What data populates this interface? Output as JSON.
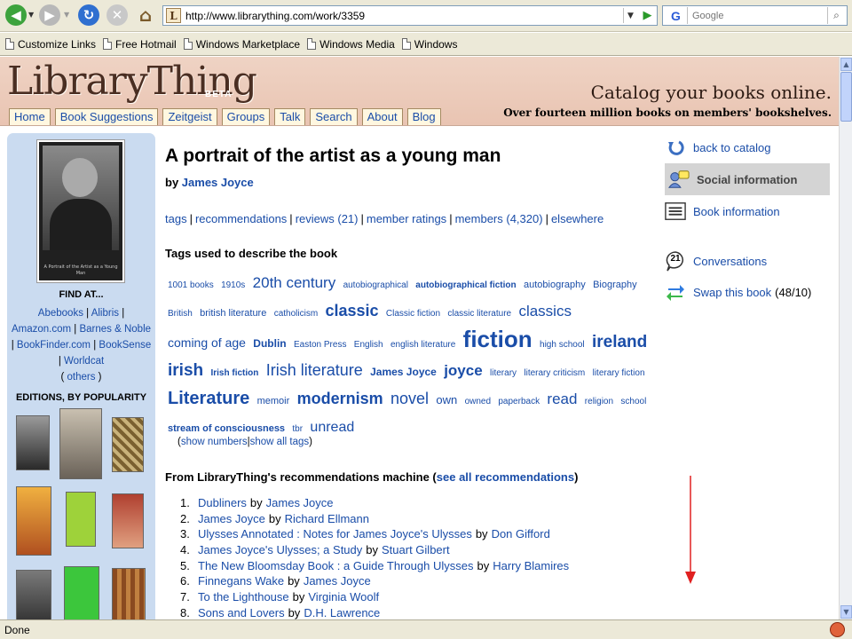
{
  "browser": {
    "url": "http://www.librarything.com/work/3359",
    "search_placeholder": "Google",
    "search_engine_letter": "G",
    "site_icon_letter": "L",
    "bookmarks": [
      "Customize Links",
      "Free Hotmail",
      "Windows Marketplace",
      "Windows Media",
      "Windows"
    ],
    "status": "Done"
  },
  "site": {
    "logo": "LibraryThing",
    "beta": "BETA",
    "tagline": "Catalog your books online.",
    "subtagline": "Over fourteen million books on members' bookshelves.",
    "tabs": [
      "Home",
      "Book Suggestions",
      "Zeitgeist",
      "Groups",
      "Talk",
      "Search",
      "About",
      "Blog"
    ]
  },
  "book": {
    "title": "A portrait of the artist as a young man",
    "by_label": "by",
    "author": "James Joyce",
    "cover_text": "A Portrait of the Artist as a Young Man"
  },
  "subnav": {
    "tags": "tags",
    "recommendations": "recommendations",
    "reviews": "reviews (21)",
    "member_ratings": "member ratings",
    "members": "members (4,320)",
    "elsewhere": "elsewhere"
  },
  "tags_heading": "Tags used to describe the book",
  "tags": [
    {
      "t": "1001 books",
      "s": 10
    },
    {
      "t": "1910s",
      "s": 10
    },
    {
      "t": "20th century",
      "s": 17
    },
    {
      "t": "autobiographical",
      "s": 10
    },
    {
      "t": "autobiographical fiction",
      "s": 10,
      "b": true
    },
    {
      "t": "autobiography",
      "s": 11
    },
    {
      "t": "Biography",
      "s": 11
    },
    {
      "t": "British",
      "s": 10
    },
    {
      "t": "british literature",
      "s": 11
    },
    {
      "t": "catholicism",
      "s": 10
    },
    {
      "t": "classic",
      "s": 18,
      "b": true
    },
    {
      "t": "Classic fiction",
      "s": 10
    },
    {
      "t": "classic literature",
      "s": 10
    },
    {
      "t": "classics",
      "s": 17
    },
    {
      "t": "coming of age",
      "s": 14
    },
    {
      "t": "Dublin",
      "s": 12,
      "b": true
    },
    {
      "t": "Easton Press",
      "s": 10
    },
    {
      "t": "English",
      "s": 10
    },
    {
      "t": "english literature",
      "s": 10
    },
    {
      "t": "fiction",
      "s": 26,
      "b": true
    },
    {
      "t": "high school",
      "s": 10
    },
    {
      "t": "ireland",
      "s": 19,
      "b": true
    },
    {
      "t": "irish",
      "s": 19,
      "b": true
    },
    {
      "t": "Irish fiction",
      "s": 10,
      "b": true
    },
    {
      "t": "Irish literature",
      "s": 18
    },
    {
      "t": "James Joyce",
      "s": 12,
      "b": true
    },
    {
      "t": "joyce",
      "s": 17,
      "b": true
    },
    {
      "t": "literary",
      "s": 10
    },
    {
      "t": "literary criticism",
      "s": 10
    },
    {
      "t": "literary fiction",
      "s": 10
    },
    {
      "t": "Literature",
      "s": 20,
      "b": true
    },
    {
      "t": "memoir",
      "s": 11
    },
    {
      "t": "modernism",
      "s": 18,
      "b": true
    },
    {
      "t": "novel",
      "s": 18
    },
    {
      "t": "own",
      "s": 13
    },
    {
      "t": "owned",
      "s": 10
    },
    {
      "t": "paperback",
      "s": 10
    },
    {
      "t": "read",
      "s": 17
    },
    {
      "t": "religion",
      "s": 10
    },
    {
      "t": "school",
      "s": 10
    },
    {
      "t": "stream of consciousness",
      "s": 11,
      "b": true
    },
    {
      "t": "tbr",
      "s": 10
    },
    {
      "t": "unread",
      "s": 16
    }
  ],
  "tag_actions": {
    "open": "(",
    "show_numbers": "show numbers",
    "sep": "|",
    "show_all": "show all tags",
    "close": ")"
  },
  "recommendations": {
    "heading_pre": "From LibraryThing's recommendations machine (",
    "heading_link": "see all recommendations",
    "heading_post": ")",
    "by_label": "by",
    "items": [
      {
        "n": "1.",
        "title": "Dubliners",
        "author": "James Joyce"
      },
      {
        "n": "2.",
        "title": "James Joyce",
        "author": "Richard Ellmann"
      },
      {
        "n": "3.",
        "title": "Ulysses Annotated : Notes for James Joyce's Ulysses",
        "author": "Don Gifford"
      },
      {
        "n": "4.",
        "title": "James Joyce's Ulysses; a Study",
        "author": "Stuart Gilbert"
      },
      {
        "n": "5.",
        "title": "The New Bloomsday Book : a Guide Through Ulysses",
        "author": "Harry Blamires"
      },
      {
        "n": "6.",
        "title": "Finnegans Wake",
        "author": "James Joyce"
      },
      {
        "n": "7.",
        "title": "To the Lighthouse",
        "author": "Virginia Woolf"
      },
      {
        "n": "8.",
        "title": "Sons and Lovers",
        "author": "D.H. Lawrence"
      }
    ]
  },
  "sidebar": {
    "find_at": "FIND AT...",
    "stores": [
      "Abebooks",
      "Alibris",
      "Amazon.com",
      "Barnes & Noble",
      "BookFinder.com",
      "BookSense",
      "Worldcat"
    ],
    "others": "others",
    "editions_heading": "EDITIONS, BY POPULARITY"
  },
  "right": {
    "back": "back to catalog",
    "social": "Social information",
    "bookinfo": "Book information",
    "conversations": "Conversations",
    "conversations_count": "21",
    "swap": "Swap this book",
    "swap_count": "(48/10)"
  },
  "colors": {
    "link": "#1a4da8",
    "header_bg": "#e9c4b2",
    "sidebar_bg": "#cadbf0",
    "arrow": "#e02020"
  }
}
